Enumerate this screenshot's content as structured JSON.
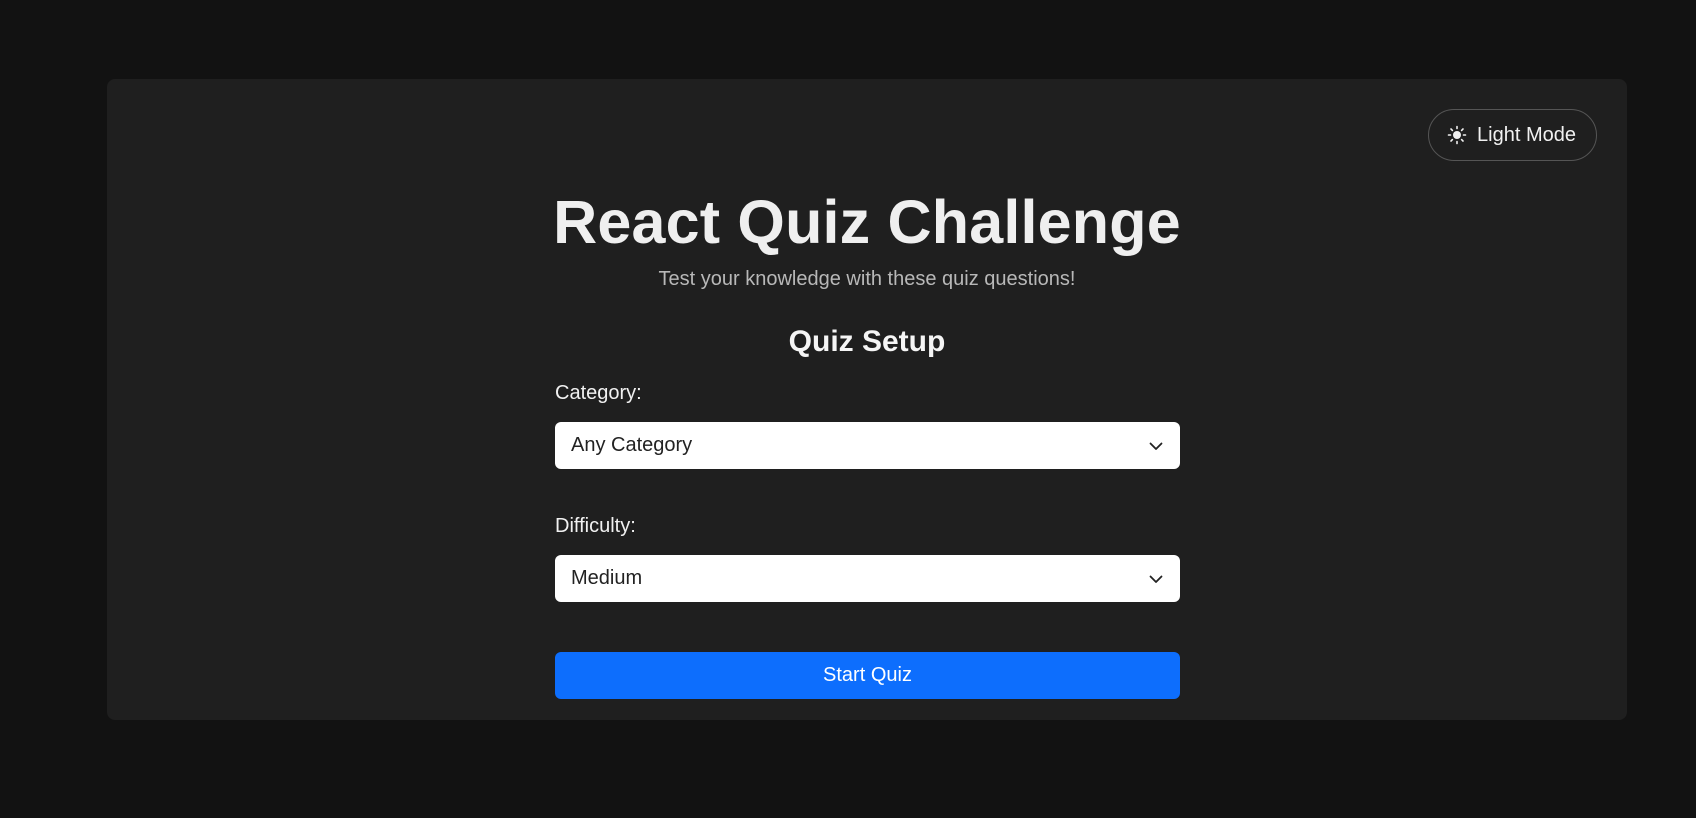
{
  "header": {
    "theme_toggle_label": "Light Mode",
    "theme_toggle_icon": "sun-icon"
  },
  "hero": {
    "title": "React Quiz Challenge",
    "subtitle": "Test your knowledge with these quiz questions!"
  },
  "setup": {
    "heading": "Quiz Setup",
    "category": {
      "label": "Category:",
      "selected": "Any Category",
      "icon": "chevron-down-icon"
    },
    "difficulty": {
      "label": "Difficulty:",
      "selected": "Medium",
      "icon": "chevron-down-icon"
    },
    "start_label": "Start Quiz"
  },
  "colors": {
    "page_background": "#121212",
    "card_background": "#1f1f1f",
    "accent": "#0d6efd",
    "text_primary": "#f1f1f1",
    "text_secondary": "#b8b8b8"
  }
}
